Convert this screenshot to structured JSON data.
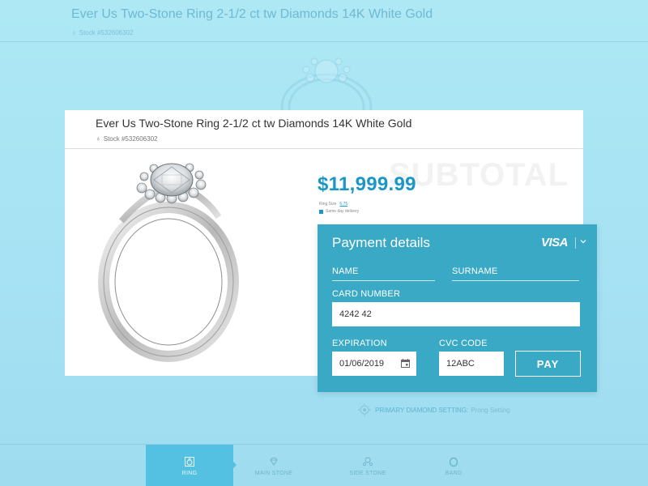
{
  "background": {
    "title": "Ever Us Two-Stone Ring 2-1/2 ct tw Diamonds 14K White Gold",
    "stock": "Stock #532606302",
    "setting_label": "PRIMARY DIAMOND SETTING:",
    "setting_value": "Prong Setting"
  },
  "product": {
    "title": "Ever Us Two-Stone Ring 2-1/2 ct tw Diamonds 14K White Gold",
    "stock": "Stock #532606302",
    "subtotal_ghost": "SUBTOTAL",
    "price": "$11,999.99",
    "ring_size_label": "Ring Size",
    "ring_size_value": "6.75",
    "delivery": "Same day delivery"
  },
  "payment": {
    "title": "Payment details",
    "card_brand": "VISA",
    "name_label": "NAME",
    "surname_label": "SURNAME",
    "card_number_label": "CARD NUMBER",
    "card_number_value": "4242 42",
    "expiration_label": "EXPIRATION",
    "expiration_value": "01/06/2019",
    "cvc_label": "CVC CODE",
    "cvc_value": "12ABC",
    "pay_label": "PAY"
  },
  "nav": {
    "items": [
      {
        "label": "RING",
        "active": true
      },
      {
        "label": "MAIN STONE",
        "active": false
      },
      {
        "label": "SIDE STONE",
        "active": false
      },
      {
        "label": "BAND",
        "active": false
      }
    ]
  },
  "colors": {
    "accent": "#1997c6",
    "panel": "#3aa9c6",
    "nav_active": "#54c0e2",
    "background": "#aee8f5"
  },
  "icons": [
    "ring-icon",
    "calendar-icon",
    "chevron-down-icon",
    "diamond-icon",
    "side-stone-icon",
    "band-icon",
    "setting-icon"
  ]
}
